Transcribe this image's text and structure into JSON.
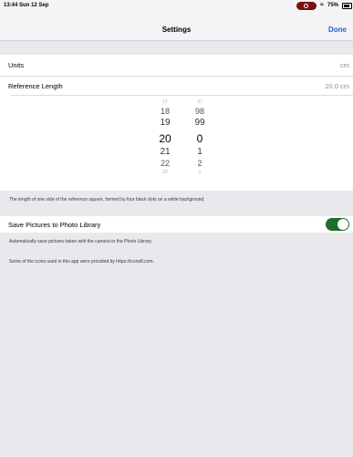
{
  "status_bar": {
    "time": "13:44  Sun 12 Sep",
    "battery": "75%"
  },
  "nav": {
    "title": "Settings",
    "done_label": "Done"
  },
  "settings": {
    "units": {
      "label": "Units",
      "value": "cm"
    },
    "reference_length": {
      "label": "Reference Length",
      "value": "20.0 cm"
    },
    "picker": {
      "integer_column": [
        "17",
        "18",
        "19",
        "20",
        "21",
        "22",
        "23"
      ],
      "decimal_column": [
        "97",
        "98",
        "99",
        "0",
        "1",
        "2",
        "3"
      ],
      "selected_integer": "20",
      "selected_decimal": "0"
    },
    "reference_description": "The length of one side of the reference square, formed by four black dots on a white background.",
    "save_pictures": {
      "label": "Save Pictures to Photo Library",
      "enabled": true,
      "description": "Automatically save pictures taken with the camera to the Photo Library."
    },
    "credit": "Some of the icons used in this app were provided by https://icons8.com."
  },
  "colors": {
    "accent": "#1f62c8",
    "toggle_on": "#1e6e2a",
    "background": "#e8e8ed",
    "record_indicator": "#7a1010"
  }
}
